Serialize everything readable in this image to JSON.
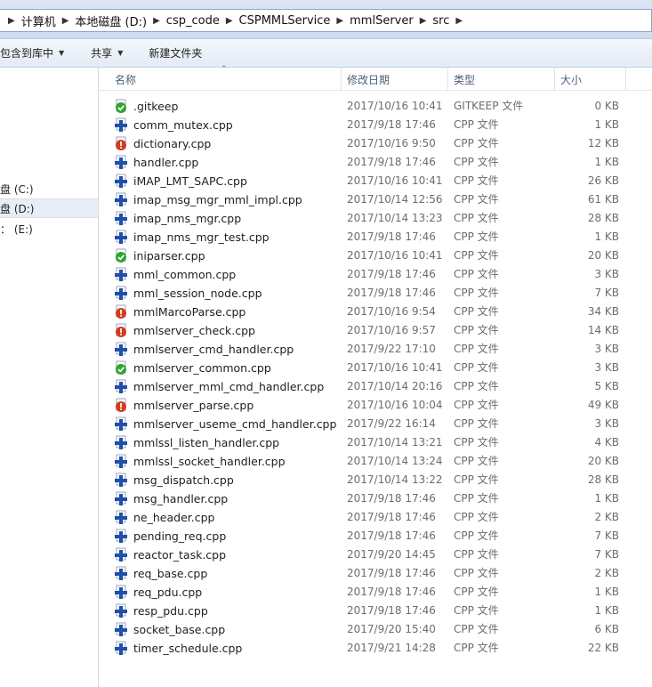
{
  "breadcrumb": [
    "计算机",
    "本地磁盘 (D:)",
    "csp_code",
    "CSPMMLService",
    "mmlServer",
    "src"
  ],
  "toolbar": {
    "include_library": "包含到库中",
    "share": "共享",
    "new_folder": "新建文件夹"
  },
  "nav": {
    "drive_c": "盘 (C:)",
    "drive_d": "盘 (D:)",
    "drive_e": "： (E:)"
  },
  "columns": {
    "name": "名称",
    "date": "修改日期",
    "type": "类型",
    "size": "大小"
  },
  "files": [
    {
      "name": ".gitkeep",
      "date": "2017/10/16 10:41",
      "type": "GITKEEP 文件",
      "size": "0 KB",
      "icon": "git-ok-icon"
    },
    {
      "name": "comm_mutex.cpp",
      "date": "2017/9/18 17:46",
      "type": "CPP 文件",
      "size": "1 KB",
      "icon": "cpp-file-icon"
    },
    {
      "name": "dictionary.cpp",
      "date": "2017/10/16 9:50",
      "type": "CPP 文件",
      "size": "12 KB",
      "icon": "git-modified-icon"
    },
    {
      "name": "handler.cpp",
      "date": "2017/9/18 17:46",
      "type": "CPP 文件",
      "size": "1 KB",
      "icon": "cpp-file-icon"
    },
    {
      "name": "iMAP_LMT_SAPC.cpp",
      "date": "2017/10/16 10:41",
      "type": "CPP 文件",
      "size": "26 KB",
      "icon": "cpp-file-icon"
    },
    {
      "name": "imap_msg_mgr_mml_impl.cpp",
      "date": "2017/10/14 12:56",
      "type": "CPP 文件",
      "size": "61 KB",
      "icon": "cpp-file-icon"
    },
    {
      "name": "imap_nms_mgr.cpp",
      "date": "2017/10/14 13:23",
      "type": "CPP 文件",
      "size": "28 KB",
      "icon": "cpp-file-icon"
    },
    {
      "name": "imap_nms_mgr_test.cpp",
      "date": "2017/9/18 17:46",
      "type": "CPP 文件",
      "size": "1 KB",
      "icon": "cpp-file-icon"
    },
    {
      "name": "iniparser.cpp",
      "date": "2017/10/16 10:41",
      "type": "CPP 文件",
      "size": "20 KB",
      "icon": "git-ok-icon"
    },
    {
      "name": "mml_common.cpp",
      "date": "2017/9/18 17:46",
      "type": "CPP 文件",
      "size": "3 KB",
      "icon": "cpp-file-icon"
    },
    {
      "name": "mml_session_node.cpp",
      "date": "2017/9/18 17:46",
      "type": "CPP 文件",
      "size": "7 KB",
      "icon": "cpp-file-icon"
    },
    {
      "name": "mmlMarcoParse.cpp",
      "date": "2017/10/16 9:54",
      "type": "CPP 文件",
      "size": "34 KB",
      "icon": "git-modified-icon"
    },
    {
      "name": "mmlserver_check.cpp",
      "date": "2017/10/16 9:57",
      "type": "CPP 文件",
      "size": "14 KB",
      "icon": "git-modified-icon"
    },
    {
      "name": "mmlserver_cmd_handler.cpp",
      "date": "2017/9/22 17:10",
      "type": "CPP 文件",
      "size": "3 KB",
      "icon": "cpp-file-icon"
    },
    {
      "name": "mmlserver_common.cpp",
      "date": "2017/10/16 10:41",
      "type": "CPP 文件",
      "size": "3 KB",
      "icon": "git-ok-icon"
    },
    {
      "name": "mmlserver_mml_cmd_handler.cpp",
      "date": "2017/10/14 20:16",
      "type": "CPP 文件",
      "size": "5 KB",
      "icon": "cpp-file-icon"
    },
    {
      "name": "mmlserver_parse.cpp",
      "date": "2017/10/16 10:04",
      "type": "CPP 文件",
      "size": "49 KB",
      "icon": "git-modified-icon"
    },
    {
      "name": "mmlserver_useme_cmd_handler.cpp",
      "date": "2017/9/22 16:14",
      "type": "CPP 文件",
      "size": "3 KB",
      "icon": "cpp-file-icon"
    },
    {
      "name": "mmlssl_listen_handler.cpp",
      "date": "2017/10/14 13:21",
      "type": "CPP 文件",
      "size": "4 KB",
      "icon": "cpp-file-icon"
    },
    {
      "name": "mmlssl_socket_handler.cpp",
      "date": "2017/10/14 13:24",
      "type": "CPP 文件",
      "size": "20 KB",
      "icon": "cpp-file-icon"
    },
    {
      "name": "msg_dispatch.cpp",
      "date": "2017/10/14 13:22",
      "type": "CPP 文件",
      "size": "28 KB",
      "icon": "cpp-file-icon"
    },
    {
      "name": "msg_handler.cpp",
      "date": "2017/9/18 17:46",
      "type": "CPP 文件",
      "size": "1 KB",
      "icon": "cpp-file-icon"
    },
    {
      "name": "ne_header.cpp",
      "date": "2017/9/18 17:46",
      "type": "CPP 文件",
      "size": "2 KB",
      "icon": "cpp-file-icon"
    },
    {
      "name": "pending_req.cpp",
      "date": "2017/9/18 17:46",
      "type": "CPP 文件",
      "size": "7 KB",
      "icon": "cpp-file-icon"
    },
    {
      "name": "reactor_task.cpp",
      "date": "2017/9/20 14:45",
      "type": "CPP 文件",
      "size": "7 KB",
      "icon": "cpp-file-icon"
    },
    {
      "name": "req_base.cpp",
      "date": "2017/9/18 17:46",
      "type": "CPP 文件",
      "size": "2 KB",
      "icon": "cpp-file-icon"
    },
    {
      "name": "req_pdu.cpp",
      "date": "2017/9/18 17:46",
      "type": "CPP 文件",
      "size": "1 KB",
      "icon": "cpp-file-icon"
    },
    {
      "name": "resp_pdu.cpp",
      "date": "2017/9/18 17:46",
      "type": "CPP 文件",
      "size": "1 KB",
      "icon": "cpp-file-icon"
    },
    {
      "name": "socket_base.cpp",
      "date": "2017/9/20 15:40",
      "type": "CPP 文件",
      "size": "6 KB",
      "icon": "cpp-file-icon"
    },
    {
      "name": "timer_schedule.cpp",
      "date": "2017/9/21 14:28",
      "type": "CPP 文件",
      "size": "22 KB",
      "icon": "cpp-file-icon"
    }
  ],
  "colors": {
    "cpp_icon": "#1f4fa8",
    "git_ok": "#2fa52f",
    "git_modified": "#d43a20"
  }
}
